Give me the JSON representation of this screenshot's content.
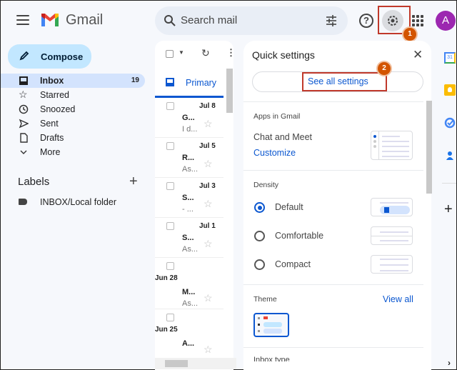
{
  "app": {
    "name": "Gmail",
    "logo_icon": "gmail-m-logo"
  },
  "search": {
    "placeholder": "Search mail"
  },
  "header": {
    "avatar_letter": "A",
    "help_glyph": "?"
  },
  "annotations": [
    {
      "number": "1",
      "target": "settings-gear"
    },
    {
      "number": "2",
      "target": "see-all-settings"
    }
  ],
  "sidebar": {
    "compose_label": "Compose",
    "items": [
      {
        "label": "Inbox",
        "count": "19",
        "icon": "inbox-icon",
        "active": true
      },
      {
        "label": "Starred",
        "icon": "star-icon"
      },
      {
        "label": "Snoozed",
        "icon": "clock-icon"
      },
      {
        "label": "Sent",
        "icon": "send-icon"
      },
      {
        "label": "Drafts",
        "icon": "draft-icon"
      },
      {
        "label": "More",
        "icon": "chevron-down-icon"
      }
    ],
    "labels_heading": "Labels",
    "labels": [
      {
        "label": "INBOX/Local folder"
      }
    ]
  },
  "mail_list": {
    "tab": "Primary",
    "rows": [
      {
        "date": "Jul 8",
        "subject": "G...",
        "snippet": "I d..."
      },
      {
        "date": "Jul 5",
        "subject": "R...",
        "snippet": "As..."
      },
      {
        "date": "Jul 3",
        "subject": "S...",
        "snippet": "- ..."
      },
      {
        "date": "Jul 1",
        "subject": "S...",
        "snippet": "As..."
      },
      {
        "date": "Jun 28",
        "subject": "M...",
        "snippet": "As..."
      },
      {
        "date": "Jun 25",
        "subject": "A...",
        "snippet": ""
      }
    ]
  },
  "quick_settings": {
    "title": "Quick settings",
    "see_all": "See all settings",
    "apps_heading": "Apps in Gmail",
    "chat_meet": "Chat and Meet",
    "customize": "Customize",
    "density_heading": "Density",
    "density_options": [
      {
        "label": "Default",
        "selected": true
      },
      {
        "label": "Comfortable",
        "selected": false
      },
      {
        "label": "Compact",
        "selected": false
      }
    ],
    "theme_heading": "Theme",
    "view_all": "View all",
    "next_heading_partial": "Inbox type"
  },
  "colors": {
    "accent": "#0b57d0",
    "annotation": "#c0392b",
    "compose_bg": "#c2e7ff",
    "avatar": "#9c27b0"
  }
}
